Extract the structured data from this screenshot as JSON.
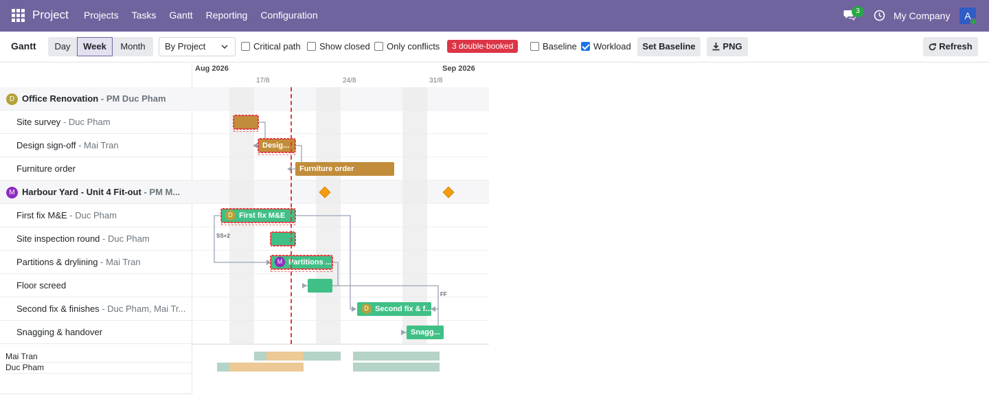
{
  "nav": {
    "app_name": "Project",
    "menu": [
      "Projects",
      "Tasks",
      "Gantt",
      "Reporting",
      "Configuration"
    ],
    "chat_count": "3",
    "company": "My Company",
    "user_initial": "A"
  },
  "controls": {
    "title": "Gantt",
    "scales": [
      "Day",
      "Week",
      "Month"
    ],
    "active_scale": "Week",
    "group_by": "By Project",
    "checks": [
      {
        "label": "Critical path",
        "checked": false
      },
      {
        "label": "Show closed",
        "checked": false
      },
      {
        "label": "Only conflicts",
        "checked": false
      }
    ],
    "conflict_badge": "3 double-booked",
    "baseline_label": "Baseline",
    "baseline_checked": false,
    "workload_label": "Workload",
    "workload_checked": true,
    "set_baseline": "Set Baseline",
    "png": "PNG",
    "refresh": "Refresh"
  },
  "timeline": {
    "months": [
      "Aug 2026",
      "Sep 2026"
    ],
    "weeks": [
      "17/8",
      "24/8",
      "31/8"
    ]
  },
  "rows": [
    {
      "type": "project",
      "name": "Office Renovation",
      "sub": "- PM Duc Pham",
      "initial": "D",
      "color": "#b5a23a"
    },
    {
      "type": "task",
      "name": "Site survey",
      "sub": "- Duc Pham"
    },
    {
      "type": "task",
      "name": "Design sign-off",
      "sub": "- Mai Tran"
    },
    {
      "type": "task",
      "name": "Furniture order",
      "sub": ""
    },
    {
      "type": "project",
      "name": "Harbour Yard - Unit 4 Fit-out",
      "sub": "- PM M...",
      "initial": "M",
      "color": "#8e2bbf"
    },
    {
      "type": "task",
      "name": "First fix M&E",
      "sub": "- Duc Pham"
    },
    {
      "type": "task",
      "name": "Site inspection round",
      "sub": "- Duc Pham"
    },
    {
      "type": "task",
      "name": "Partitions & drylining",
      "sub": "- Mai Tran"
    },
    {
      "type": "task",
      "name": "Floor screed",
      "sub": ""
    },
    {
      "type": "task",
      "name": "Second fix & finishes",
      "sub": "- Duc Pham, Mai Tr..."
    },
    {
      "type": "task",
      "name": "Snagging & handover",
      "sub": ""
    }
  ],
  "bars": {
    "design": "Desig...",
    "furniture": "Furniture order",
    "first_fix": "First fix M&E",
    "first_fix_initial": "D",
    "partitions": "Partitions ...",
    "partitions_initial": "M",
    "second_fix": "Second fix & f...",
    "second_fix_initial": "D",
    "snagging": "Snagg..."
  },
  "dependency_labels": {
    "ss": "SS+2",
    "ff": "FF"
  },
  "workload": {
    "people": [
      "Mai Tran",
      "Duc Pham"
    ]
  },
  "colors": {
    "nav": "#71639e",
    "task_brown": "#c28d3b",
    "task_green": "#40c086",
    "conflict": "#e03b3b",
    "milestone": "#f59d0e"
  }
}
